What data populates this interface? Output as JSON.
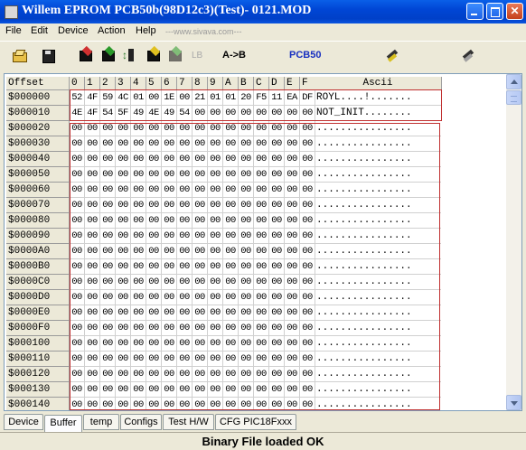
{
  "window": {
    "title": "Willem EPROM PCB50b(98D12c3)(Test)- 0121.MOD"
  },
  "menu": {
    "items": [
      "File",
      "Edit",
      "Device",
      "Action",
      "Help"
    ],
    "url": "---www.sivava.com---"
  },
  "toolbar": {
    "lb_label": "LB",
    "ab_label": "A->B",
    "pcb_label": "PCB50"
  },
  "grid": {
    "offset_header": "Offset",
    "col_headers": [
      "0",
      "1",
      "2",
      "3",
      "4",
      "5",
      "6",
      "7",
      "8",
      "9",
      "A",
      "B",
      "C",
      "D",
      "E",
      "F"
    ],
    "ascii_header": "Ascii",
    "rows": [
      {
        "offset": "$000000",
        "bytes": [
          "52",
          "4F",
          "59",
          "4C",
          "01",
          "00",
          "1E",
          "00",
          "21",
          "01",
          "01",
          "20",
          "F5",
          "11",
          "EA",
          "DF"
        ],
        "ascii": "ROYL....!......."
      },
      {
        "offset": "$000010",
        "bytes": [
          "4E",
          "4F",
          "54",
          "5F",
          "49",
          "4E",
          "49",
          "54",
          "00",
          "00",
          "00",
          "00",
          "00",
          "00",
          "00",
          "00"
        ],
        "ascii": "NOT_INIT........"
      },
      {
        "offset": "$000020",
        "bytes": [
          "00",
          "00",
          "00",
          "00",
          "00",
          "00",
          "00",
          "00",
          "00",
          "00",
          "00",
          "00",
          "00",
          "00",
          "00",
          "00"
        ],
        "ascii": "................"
      },
      {
        "offset": "$000030",
        "bytes": [
          "00",
          "00",
          "00",
          "00",
          "00",
          "00",
          "00",
          "00",
          "00",
          "00",
          "00",
          "00",
          "00",
          "00",
          "00",
          "00"
        ],
        "ascii": "................"
      },
      {
        "offset": "$000040",
        "bytes": [
          "00",
          "00",
          "00",
          "00",
          "00",
          "00",
          "00",
          "00",
          "00",
          "00",
          "00",
          "00",
          "00",
          "00",
          "00",
          "00"
        ],
        "ascii": "................"
      },
      {
        "offset": "$000050",
        "bytes": [
          "00",
          "00",
          "00",
          "00",
          "00",
          "00",
          "00",
          "00",
          "00",
          "00",
          "00",
          "00",
          "00",
          "00",
          "00",
          "00"
        ],
        "ascii": "................"
      },
      {
        "offset": "$000060",
        "bytes": [
          "00",
          "00",
          "00",
          "00",
          "00",
          "00",
          "00",
          "00",
          "00",
          "00",
          "00",
          "00",
          "00",
          "00",
          "00",
          "00"
        ],
        "ascii": "................"
      },
      {
        "offset": "$000070",
        "bytes": [
          "00",
          "00",
          "00",
          "00",
          "00",
          "00",
          "00",
          "00",
          "00",
          "00",
          "00",
          "00",
          "00",
          "00",
          "00",
          "00"
        ],
        "ascii": "................"
      },
      {
        "offset": "$000080",
        "bytes": [
          "00",
          "00",
          "00",
          "00",
          "00",
          "00",
          "00",
          "00",
          "00",
          "00",
          "00",
          "00",
          "00",
          "00",
          "00",
          "00"
        ],
        "ascii": "................"
      },
      {
        "offset": "$000090",
        "bytes": [
          "00",
          "00",
          "00",
          "00",
          "00",
          "00",
          "00",
          "00",
          "00",
          "00",
          "00",
          "00",
          "00",
          "00",
          "00",
          "00"
        ],
        "ascii": "................"
      },
      {
        "offset": "$0000A0",
        "bytes": [
          "00",
          "00",
          "00",
          "00",
          "00",
          "00",
          "00",
          "00",
          "00",
          "00",
          "00",
          "00",
          "00",
          "00",
          "00",
          "00"
        ],
        "ascii": "................"
      },
      {
        "offset": "$0000B0",
        "bytes": [
          "00",
          "00",
          "00",
          "00",
          "00",
          "00",
          "00",
          "00",
          "00",
          "00",
          "00",
          "00",
          "00",
          "00",
          "00",
          "00"
        ],
        "ascii": "................"
      },
      {
        "offset": "$0000C0",
        "bytes": [
          "00",
          "00",
          "00",
          "00",
          "00",
          "00",
          "00",
          "00",
          "00",
          "00",
          "00",
          "00",
          "00",
          "00",
          "00",
          "00"
        ],
        "ascii": "................"
      },
      {
        "offset": "$0000D0",
        "bytes": [
          "00",
          "00",
          "00",
          "00",
          "00",
          "00",
          "00",
          "00",
          "00",
          "00",
          "00",
          "00",
          "00",
          "00",
          "00",
          "00"
        ],
        "ascii": "................"
      },
      {
        "offset": "$0000E0",
        "bytes": [
          "00",
          "00",
          "00",
          "00",
          "00",
          "00",
          "00",
          "00",
          "00",
          "00",
          "00",
          "00",
          "00",
          "00",
          "00",
          "00"
        ],
        "ascii": "................"
      },
      {
        "offset": "$0000F0",
        "bytes": [
          "00",
          "00",
          "00",
          "00",
          "00",
          "00",
          "00",
          "00",
          "00",
          "00",
          "00",
          "00",
          "00",
          "00",
          "00",
          "00"
        ],
        "ascii": "................"
      },
      {
        "offset": "$000100",
        "bytes": [
          "00",
          "00",
          "00",
          "00",
          "00",
          "00",
          "00",
          "00",
          "00",
          "00",
          "00",
          "00",
          "00",
          "00",
          "00",
          "00"
        ],
        "ascii": "................"
      },
      {
        "offset": "$000110",
        "bytes": [
          "00",
          "00",
          "00",
          "00",
          "00",
          "00",
          "00",
          "00",
          "00",
          "00",
          "00",
          "00",
          "00",
          "00",
          "00",
          "00"
        ],
        "ascii": "................"
      },
      {
        "offset": "$000120",
        "bytes": [
          "00",
          "00",
          "00",
          "00",
          "00",
          "00",
          "00",
          "00",
          "00",
          "00",
          "00",
          "00",
          "00",
          "00",
          "00",
          "00"
        ],
        "ascii": "................"
      },
      {
        "offset": "$000130",
        "bytes": [
          "00",
          "00",
          "00",
          "00",
          "00",
          "00",
          "00",
          "00",
          "00",
          "00",
          "00",
          "00",
          "00",
          "00",
          "00",
          "00"
        ],
        "ascii": "................"
      },
      {
        "offset": "$000140",
        "bytes": [
          "00",
          "00",
          "00",
          "00",
          "00",
          "00",
          "00",
          "00",
          "00",
          "00",
          "00",
          "00",
          "00",
          "00",
          "00",
          "00"
        ],
        "ascii": "................"
      }
    ]
  },
  "tabs": {
    "items": [
      "Device",
      "Buffer",
      "temp",
      "Configs",
      "Test H/W",
      "CFG PIC18Fxxx"
    ],
    "active": "Buffer"
  },
  "status": {
    "message": "Binary File loaded OK"
  },
  "colors": {
    "titlebar": "#0046d5",
    "selection_border": "#c03030",
    "pcb_label": "#1830c0"
  },
  "icons": [
    "app-icon",
    "open-folder-icon",
    "save-disk-icon",
    "chip-erase-icon",
    "chip-read-icon",
    "chip-verify-icon",
    "chip-program-icon",
    "chip-blank-icon",
    "tools-icon",
    "wrench-icon"
  ]
}
